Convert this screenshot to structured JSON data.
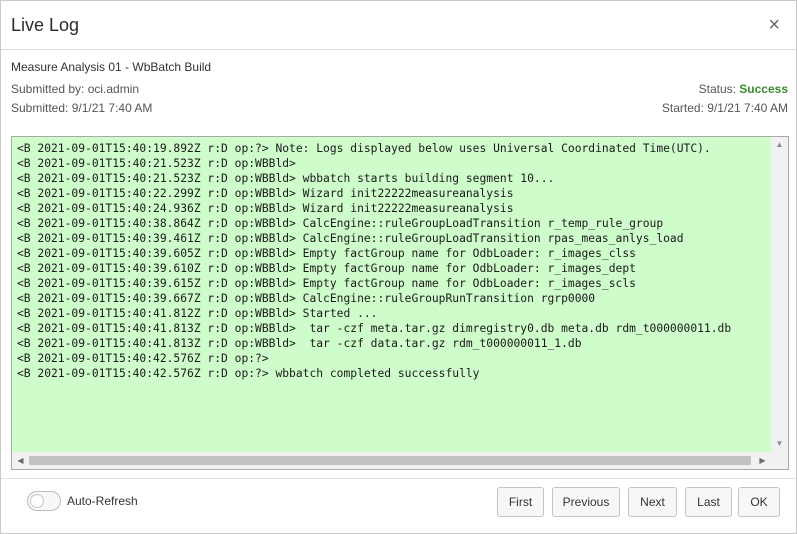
{
  "dialog": {
    "title": "Live Log",
    "close_glyph": "×"
  },
  "info": {
    "job_name": "Measure Analysis 01 - WbBatch Build",
    "submitted_by": "Submitted by: oci.admin",
    "submitted_at": "Submitted: 9/1/21 7:40 AM",
    "status_label": "Status: ",
    "status_value": "Success",
    "status_color": "#3a8a2e",
    "started_at": "Started: 9/1/21 7:40 AM"
  },
  "log": {
    "background": "#cffccb",
    "lines": [
      "<B 2021-09-01T15:40:19.892Z r:D op:?> Note: Logs displayed below uses Universal Coordinated Time(UTC).",
      "<B 2021-09-01T15:40:21.523Z r:D op:WBBld>",
      "<B 2021-09-01T15:40:21.523Z r:D op:WBBld> wbbatch starts building segment 10...",
      "<B 2021-09-01T15:40:22.299Z r:D op:WBBld> Wizard init22222measureanalysis",
      "<B 2021-09-01T15:40:24.936Z r:D op:WBBld> Wizard init22222measureanalysis",
      "<B 2021-09-01T15:40:38.864Z r:D op:WBBld> CalcEngine::ruleGroupLoadTransition r_temp_rule_group",
      "<B 2021-09-01T15:40:39.461Z r:D op:WBBld> CalcEngine::ruleGroupLoadTransition rpas_meas_anlys_load",
      "<B 2021-09-01T15:40:39.605Z r:D op:WBBld> Empty factGroup name for OdbLoader: r_images_clss",
      "<B 2021-09-01T15:40:39.610Z r:D op:WBBld> Empty factGroup name for OdbLoader: r_images_dept",
      "<B 2021-09-01T15:40:39.615Z r:D op:WBBld> Empty factGroup name for OdbLoader: r_images_scls",
      "<B 2021-09-01T15:40:39.667Z r:D op:WBBld> CalcEngine::ruleGroupRunTransition rgrp0000",
      "<B 2021-09-01T15:40:41.812Z r:D op:WBBld> Started ...",
      "<B 2021-09-01T15:40:41.813Z r:D op:WBBld>  tar -czf meta.tar.gz dimregistry0.db meta.db rdm_t000000011.db",
      "<B 2021-09-01T15:40:41.813Z r:D op:WBBld>  tar -czf data.tar.gz rdm_t000000011_1.db",
      "<B 2021-09-01T15:40:42.576Z r:D op:?>",
      "<B 2021-09-01T15:40:42.576Z r:D op:?> wbbatch completed successfully"
    ]
  },
  "scroll_icons": {
    "up": "chevron-up-icon",
    "down": "chevron-down-icon",
    "left": "chevron-left-icon",
    "right": "chevron-right-icon"
  },
  "footer": {
    "auto_refresh_label": "Auto-Refresh",
    "auto_refresh_on": false,
    "buttons": {
      "first": "First",
      "previous": "Previous",
      "next": "Next",
      "last": "Last",
      "ok": "OK"
    }
  }
}
